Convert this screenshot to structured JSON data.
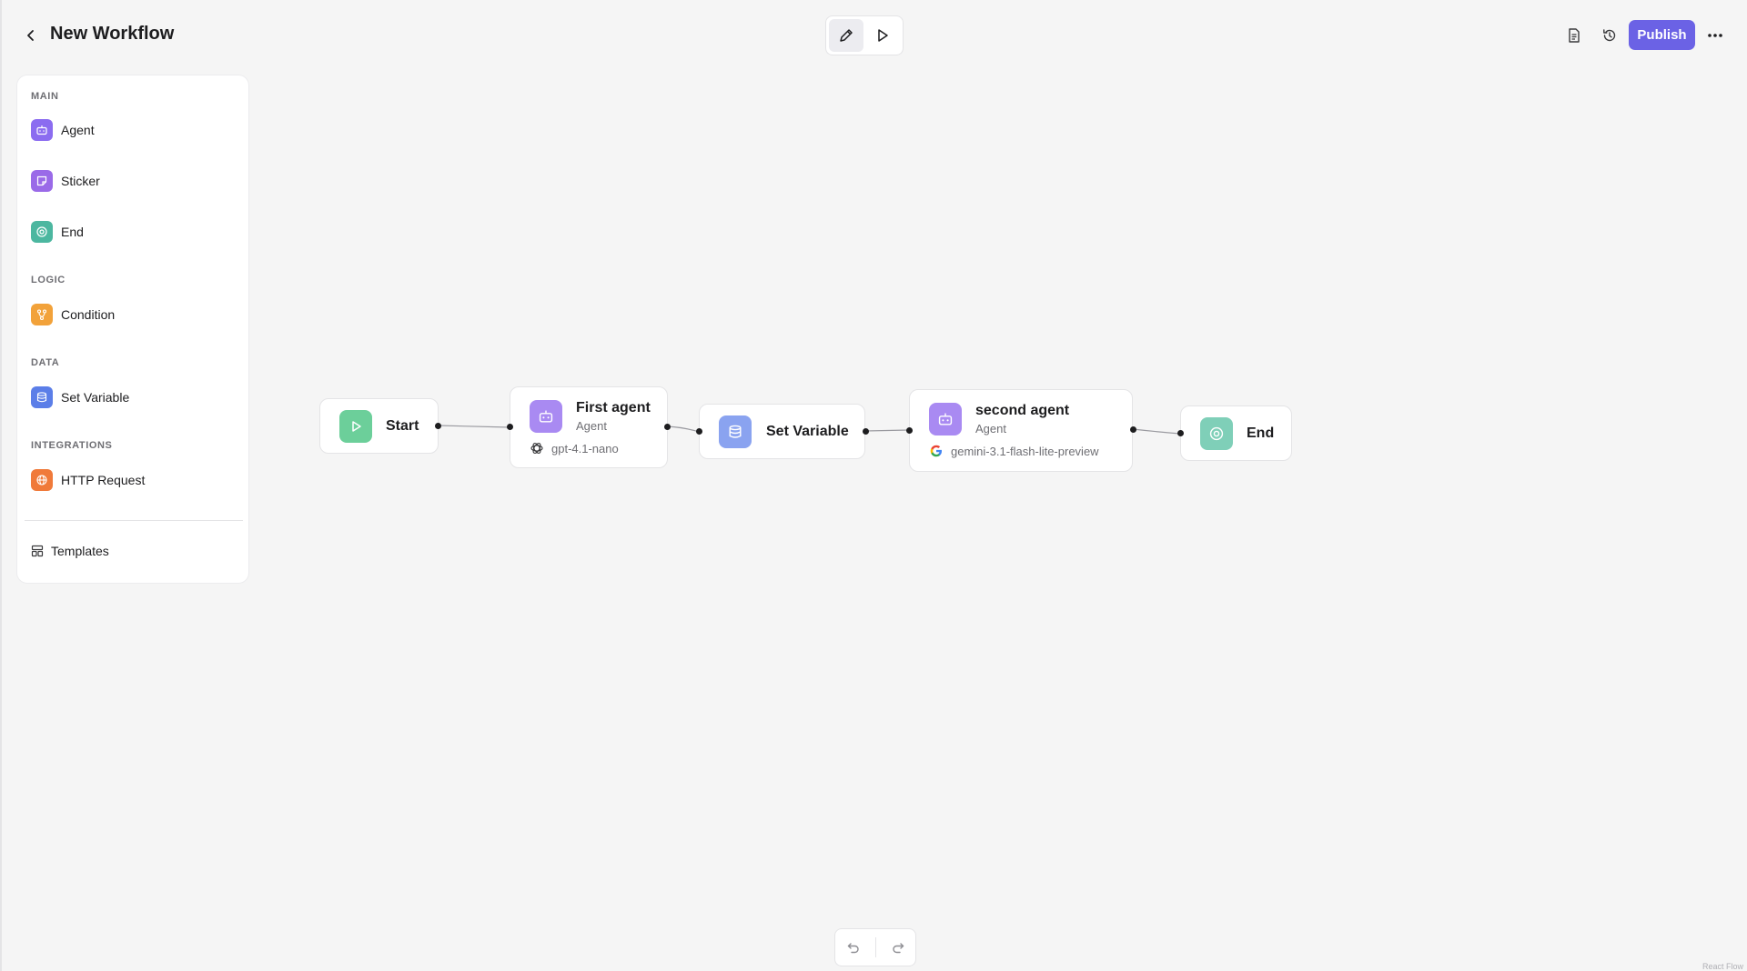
{
  "header": {
    "title": "New Workflow",
    "publish_label": "Publish",
    "icons": {
      "back": "chevron-left-icon",
      "edit": "pencil-icon",
      "run": "play-icon",
      "docs": "document-icon",
      "history": "history-icon",
      "more": "more-horizontal-icon"
    }
  },
  "sidebar": {
    "sections": [
      {
        "label": "MAIN",
        "items": [
          {
            "label": "Agent",
            "icon": "robot-icon",
            "color": "#8b6cf0"
          },
          {
            "label": "Sticker",
            "icon": "sticker-icon",
            "color": "#9a6ae8"
          },
          {
            "label": "End",
            "icon": "target-icon",
            "color": "#4cb7a0"
          }
        ]
      },
      {
        "label": "LOGIC",
        "items": [
          {
            "label": "Condition",
            "icon": "branch-icon",
            "color": "#f2a23a"
          }
        ]
      },
      {
        "label": "DATA",
        "items": [
          {
            "label": "Set Variable",
            "icon": "database-icon",
            "color": "#5b7ee8"
          }
        ]
      },
      {
        "label": "INTEGRATIONS",
        "items": [
          {
            "label": "HTTP Request",
            "icon": "globe-icon",
            "color": "#f07a3a"
          }
        ]
      }
    ],
    "templates_label": "Templates"
  },
  "workflow": {
    "nodes": [
      {
        "id": "start",
        "title": "Start",
        "icon": "play-icon",
        "color": "#6ccf9a"
      },
      {
        "id": "first-agent",
        "title": "First agent",
        "type": "Agent",
        "model": "gpt-4.1-nano",
        "model_icon": "openai-icon",
        "icon": "robot-icon",
        "color": "#a98af2"
      },
      {
        "id": "set-variable",
        "title": "Set Variable",
        "icon": "database-icon",
        "color": "#8aa3f0"
      },
      {
        "id": "second-agent",
        "title": "second agent",
        "type": "Agent",
        "model": "gemini-3.1-flash-lite-preview",
        "model_icon": "google-icon",
        "icon": "robot-icon",
        "color": "#a98af2"
      },
      {
        "id": "end",
        "title": "End",
        "icon": "target-icon",
        "color": "#7fcfb8"
      }
    ]
  },
  "footer": {
    "undo_icon": "undo-icon",
    "redo_icon": "redo-icon",
    "attribution": "React Flow"
  }
}
